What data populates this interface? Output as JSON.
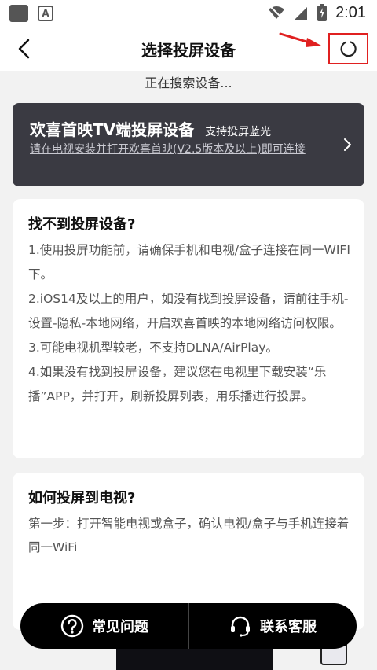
{
  "status_bar": {
    "time": "2:01"
  },
  "header": {
    "title": "选择投屏设备"
  },
  "searching_text": "正在搜索设备...",
  "tv_card": {
    "title": "欢喜首映TV端投屏设备",
    "tag": "支持投屏蓝光",
    "subtitle": "请在电视安装并打开欢喜首映(V2.5版本及以上)即可连接"
  },
  "help_card": {
    "title": "找不到投屏设备?",
    "items": [
      "1.使用投屏功能前，请确保手机和电视/盒子连接在同一WIFI下。",
      "2.iOS14及以上的用户，如没有找到投屏设备，请前往手机-设置-隐私-本地网络，开启欢喜首映的本地网络访问权限。",
      "3.可能电视机型较老，不支持DLNA/AirPlay。",
      "4.如果没有找到投屏设备，建议您在电视里下载安装“乐播”APP，并打开，刷新投屏列表，用乐播进行投屏。"
    ]
  },
  "how_card": {
    "title": "如何投屏到电视?",
    "step1": "第一步：打开智能电视或盒子，确认电视/盒子与手机连接着同一WiFi"
  },
  "bottom_bar": {
    "faq_label": "常见问题",
    "contact_label": "联系客服"
  },
  "icons": {
    "back": "back-arrow-icon",
    "refresh": "refresh-icon",
    "chevron": "chevron-right-icon",
    "faq": "question-circle-icon",
    "contact": "headset-icon",
    "wifi": "wifi-icon",
    "signal": "signal-icon",
    "battery": "battery-charging-icon"
  },
  "colors": {
    "highlight_red": "#e02020",
    "card_dark": "#3a3a42",
    "bottom_bar": "#000000"
  }
}
